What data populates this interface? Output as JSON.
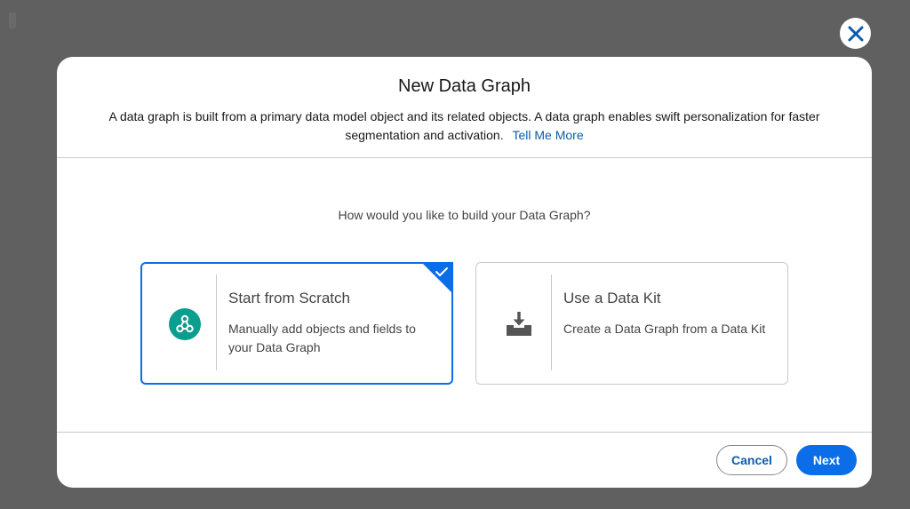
{
  "modal": {
    "title": "New Data Graph",
    "description": "A data graph is built from a primary data model object and its related objects. A data graph enables swift personalization for faster segmentation and activation.",
    "help_link": "Tell Me More",
    "question": "How would you like to build your Data Graph?"
  },
  "options": [
    {
      "title": "Start from Scratch",
      "description": "Manually add objects and fields to your Data Graph",
      "icon": "graph-nodes-icon",
      "selected": true
    },
    {
      "title": "Use a Data Kit",
      "description": "Create a Data Graph from a Data Kit",
      "icon": "download-tray-icon",
      "selected": false
    }
  ],
  "footer": {
    "cancel_label": "Cancel",
    "next_label": "Next"
  },
  "colors": {
    "accent": "#0b6ee8",
    "link": "#0b5cab",
    "icon_teal": "#0a9e8e",
    "overlay": "#606060"
  }
}
